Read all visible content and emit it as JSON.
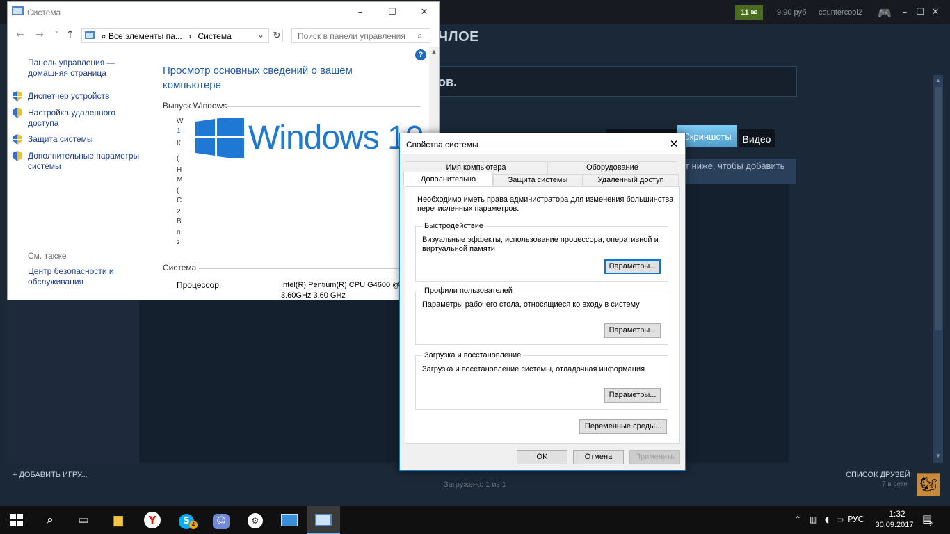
{
  "steam": {
    "badge_count": "11",
    "balance": "9,90 руб",
    "username": "countercool2",
    "heading_partial": "ЧЛОЕ",
    "panel_partial": "ов.",
    "tab_screenshots": "Скриншоты",
    "tab_video": "Видео",
    "hint_partial": "т ниже, чтобы добавить",
    "add_game": "+  ДОБАВИТЬ ИГРУ...",
    "loaded": "Загружено: 1 из 1",
    "friends_list": "СПИСОК ДРУЗЕЙ",
    "friends_online": "7 в сети"
  },
  "system_window": {
    "title": "Система",
    "address_prefix": "«",
    "address_crumb1": "Все элементы па...",
    "address_sep": "›",
    "address_crumb2": "Система",
    "search_placeholder": "Поиск в панели управления",
    "cp_home": [
      "Панель управления —",
      "домашняя страница"
    ],
    "links": [
      [
        "Диспетчер устройств"
      ],
      [
        "Настройка удаленного",
        "доступа"
      ],
      [
        "Защита системы"
      ],
      [
        "Дополнительные параметры",
        "системы"
      ]
    ],
    "see_also": "См. также",
    "see_also_link": [
      "Центр безопасности и",
      "обслуживания"
    ],
    "heading": [
      "Просмотр основных сведений о вашем",
      "компьютере"
    ],
    "windows_edition_label": "Выпуск Windows",
    "windows_logo_text": "Windows 10",
    "system_section": "Система",
    "cpu_label": "Процессор:",
    "cpu_value": [
      "Intel(R) Pentium(R) CPU G4600 @",
      "3.60GHz   3.60 GHz"
    ],
    "truncated_chars": [
      "W",
      "1",
      "К",
      "(",
      "Н",
      "М",
      "(",
      "С",
      "2",
      "В",
      "п",
      "з"
    ]
  },
  "dialog": {
    "title": "Свойства системы",
    "tabs_row1": [
      "Имя компьютера",
      "Оборудование"
    ],
    "tabs_row2": [
      "Дополнительно",
      "Защита системы",
      "Удаленный доступ"
    ],
    "admin_note": [
      "Необходимо иметь права администратора для изменения большинства",
      "перечисленных параметров."
    ],
    "groups": [
      {
        "title": "Быстродействие",
        "desc": [
          "Визуальные эффекты, использование процессора, оперативной и",
          "виртуальной памяти"
        ],
        "button": "Параметры..."
      },
      {
        "title": "Профили пользователей",
        "desc": [
          "Параметры рабочего стола, относящиеся ко входу в систему"
        ],
        "button": "Параметры..."
      },
      {
        "title": "Загрузка и восстановление",
        "desc": [
          "Загрузка и восстановление системы, отладочная информация"
        ],
        "button": "Параметры..."
      }
    ],
    "env_button": "Переменные среды...",
    "ok": "OK",
    "cancel": "Отмена",
    "apply": "Применить"
  },
  "taskbar": {
    "language": "РУС",
    "time": "1:32",
    "date": "30.09.2017",
    "notification_count": "2",
    "skype_badge": "4"
  }
}
